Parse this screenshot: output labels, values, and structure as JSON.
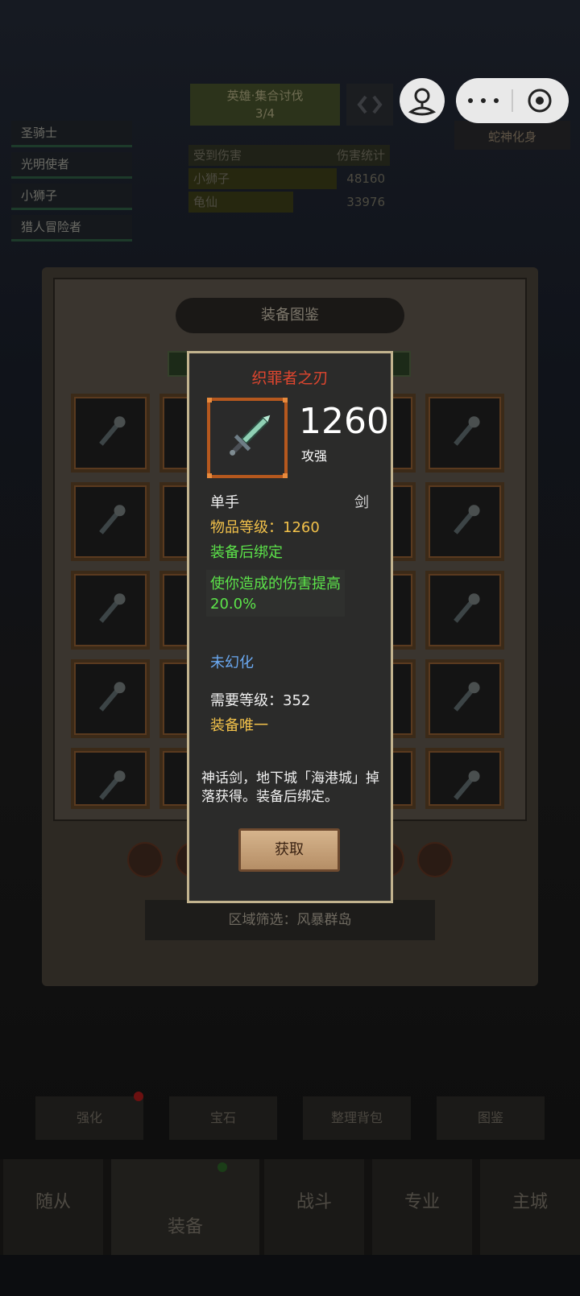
{
  "background": {
    "party_members": [
      "圣骑士",
      "光明使者",
      "小狮子",
      "猎人冒险者"
    ],
    "top_title_line1": "英雄·集合讨伐",
    "top_title_line2": "3/4",
    "ranking": [
      {
        "name": "受到伤害",
        "score": "伤害统计"
      },
      {
        "name": "小狮子",
        "score": "48160"
      },
      {
        "name": "龟仙",
        "score": "33976"
      }
    ],
    "right_tag": "蛇神化身",
    "panel_title": "装备图鉴",
    "region_filter": "区域筛选：风暴群岛",
    "bottom_buttons": [
      "强化",
      "宝石",
      "整理背包",
      "图鉴"
    ],
    "nav_items": [
      "随从",
      "装备",
      "战斗",
      "专业",
      "主城"
    ]
  },
  "tooltip": {
    "item_name": "织罪者之刃",
    "item_level_big": "1260",
    "item_level_sub": "攻强",
    "slot": "单手",
    "weapon_type": "剑",
    "item_level_line": "物品等级：1260",
    "bind": "装备后绑定",
    "effect": "使你造成的伤害提高20.0%",
    "transmog": "未幻化",
    "required_level": "需要等级：352",
    "unique": "装备唯一",
    "description": "神话剑，地下城「海港城」掉落获得。装备后绑定。",
    "acquire_button": "获取"
  },
  "colors": {
    "item_name": "#e0462f",
    "gold": "#f2c14a",
    "green": "#5ce44a",
    "blue": "#6aa8f0",
    "tooltip_border": "#c2b38e",
    "icon_frame": "#b5581e"
  },
  "icons": [
    "user-icon",
    "more-dots-icon",
    "target-icon",
    "sword-icon",
    "swap-arrows-icon"
  ]
}
